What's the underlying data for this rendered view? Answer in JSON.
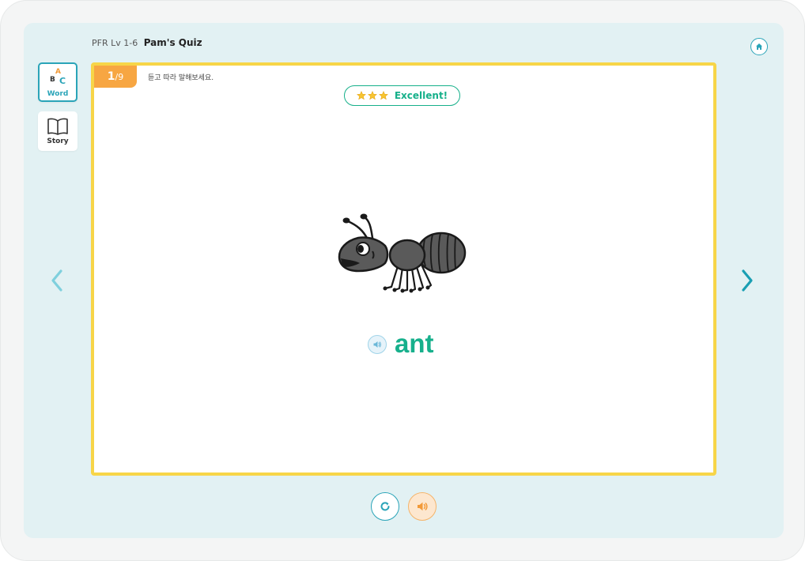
{
  "header": {
    "level": "PFR Lv 1-6",
    "title": "Pam's Quiz",
    "home_icon": "home-icon"
  },
  "sidebar": {
    "items": [
      {
        "label": "Word",
        "icon": "abc-blocks-icon",
        "active": true
      },
      {
        "label": "Story",
        "icon": "open-book-icon",
        "active": false
      }
    ]
  },
  "quiz": {
    "progress_current": "1",
    "progress_total": "/9",
    "instruction": "듣고 따라 말해보세요.",
    "rating_stars": 3,
    "rating_text": "Excellent!",
    "word": "ant",
    "image": "ant-illustration"
  },
  "controls": {
    "prev_icon": "chevron-left-icon",
    "next_icon": "chevron-right-icon",
    "replay_icon": "replay-icon",
    "sound_icon": "speaker-icon"
  },
  "colors": {
    "accent_teal": "#2aa4b8",
    "word_green": "#17b08c",
    "card_border": "#f7d548",
    "progress_orange": "#f7a642",
    "screen_bg": "#e2f1f3"
  }
}
